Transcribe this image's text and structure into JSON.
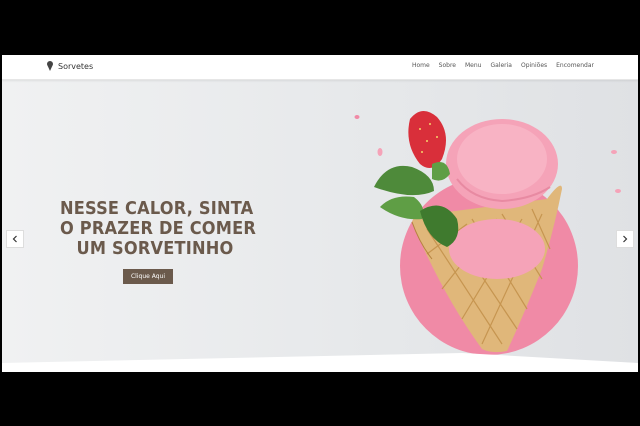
{
  "brand": {
    "name": "Sorvetes",
    "icon": "ice-cream-icon"
  },
  "nav": {
    "items": [
      "Home",
      "Sobre",
      "Menu",
      "Galeria",
      "Opiniões",
      "Encomendar"
    ]
  },
  "hero": {
    "headline_lines": [
      "NESSE CALOR, SINTA",
      "O PRAZER DE COMER",
      "UM SORVETINHO"
    ],
    "cta_label": "Clique Aqui"
  },
  "colors": {
    "accent": "#6b5a4c",
    "pink": "#f08aa6",
    "icecream": "#f5a3b8"
  }
}
